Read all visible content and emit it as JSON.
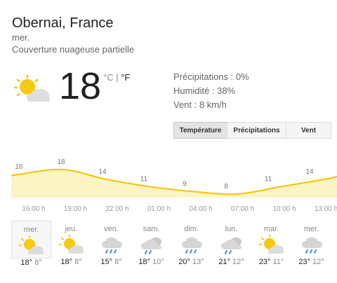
{
  "location": "Obernai, France",
  "day": "mer.",
  "condition": "Couverture nuageuse partielle",
  "current": {
    "temp": "18",
    "unit_c": "°C",
    "unit_sep": " | ",
    "unit_f": "°F",
    "icon": "partly-cloudy-icon"
  },
  "details": {
    "precip": "Précipitations : 0%",
    "humidity": "Humidité : 38%",
    "wind": "Vent : 8 km/h"
  },
  "tabs": [
    "Température",
    "Précipitations",
    "Vent"
  ],
  "selected_tab": "Température",
  "chart_data": {
    "type": "area",
    "x": [
      "16:00 h",
      "19:00 h",
      "22:00 h",
      "01:00 h",
      "04:00 h",
      "07:00 h",
      "10:00 h",
      "13:00 h"
    ],
    "values": [
      16,
      18,
      14,
      11,
      9,
      8,
      11,
      14
    ],
    "ylabel": "Température",
    "colors": {
      "line": "#f4c400",
      "fill": "#fdf4c4"
    }
  },
  "forecast": [
    {
      "day": "mer.",
      "icon": "partly-cloudy-icon",
      "hi": "18",
      "lo": "8",
      "deg": "°",
      "selected": true
    },
    {
      "day": "jeu.",
      "icon": "partly-cloudy-icon",
      "hi": "18",
      "lo": "8",
      "deg": "°"
    },
    {
      "day": "ven.",
      "icon": "rain-icon",
      "hi": "15",
      "lo": "8",
      "deg": "°"
    },
    {
      "day": "sam.",
      "icon": "rain-cloud-icon",
      "hi": "18",
      "lo": "10",
      "deg": "°"
    },
    {
      "day": "dim.",
      "icon": "rain-icon",
      "hi": "20",
      "lo": "13",
      "deg": "°"
    },
    {
      "day": "lun.",
      "icon": "rain-cloud-icon",
      "hi": "21",
      "lo": "12",
      "deg": "°"
    },
    {
      "day": "mar.",
      "icon": "partly-cloudy-icon",
      "hi": "23",
      "lo": "11",
      "deg": "°"
    },
    {
      "day": "mer.",
      "icon": "rain-icon",
      "hi": "23",
      "lo": "12",
      "deg": "°"
    }
  ]
}
